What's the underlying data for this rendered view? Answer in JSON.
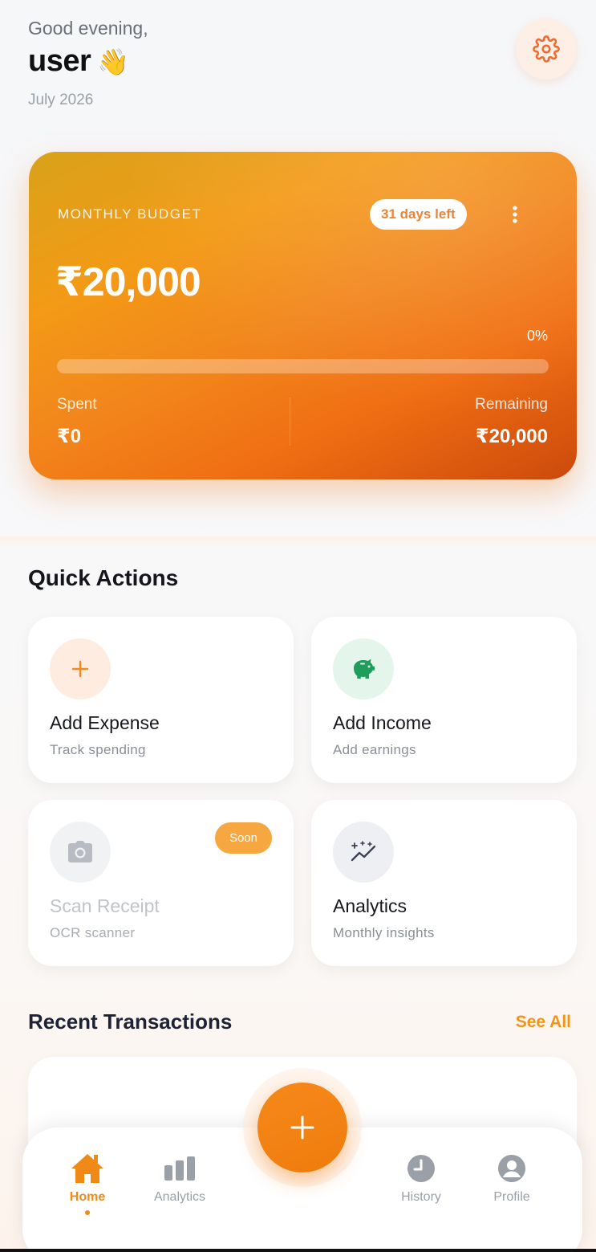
{
  "header": {
    "greeting": "Good evening,",
    "username": "user",
    "wave_emoji": "👋",
    "date": "July 2026",
    "settings_icon": "gear-icon"
  },
  "budget": {
    "label": "MONTHLY BUDGET",
    "days_left": "31 days left",
    "amount": "₹20,000",
    "percent_text": "0%",
    "progress_fraction": 0,
    "spent_label": "Spent",
    "spent_value": "₹0",
    "remaining_label": "Remaining",
    "remaining_value": "₹20,000"
  },
  "quick_actions": {
    "title": "Quick Actions",
    "items": [
      {
        "name": "Add Expense",
        "sub": "Track spending",
        "icon": "plus-icon",
        "color": "#f28a1e"
      },
      {
        "name": "Add Income",
        "sub": "Add earnings",
        "icon": "piggy-bank-icon",
        "color": "#1f9d5b"
      },
      {
        "name": "Scan Receipt",
        "sub": "OCR scanner",
        "icon": "camera-icon",
        "badge": "Soon",
        "color": "#b8bcc2"
      },
      {
        "name": "Analytics",
        "sub": "Monthly insights",
        "icon": "sparkle-chart-icon",
        "color": "#3a3f52"
      }
    ]
  },
  "recent": {
    "title": "Recent Transactions",
    "see_all": "See All"
  },
  "nav": {
    "items": [
      {
        "label": "Home",
        "icon": "home-icon",
        "active": true
      },
      {
        "label": "Analytics",
        "icon": "bar-chart-icon"
      },
      {
        "label": "History",
        "icon": "clock-icon"
      },
      {
        "label": "Profile",
        "icon": "user-icon"
      }
    ],
    "fab_icon": "plus-icon"
  },
  "colors": {
    "accent": "#f08a16",
    "budget_card_start": "#d9a21a",
    "budget_card_end": "#cc4a0c"
  }
}
